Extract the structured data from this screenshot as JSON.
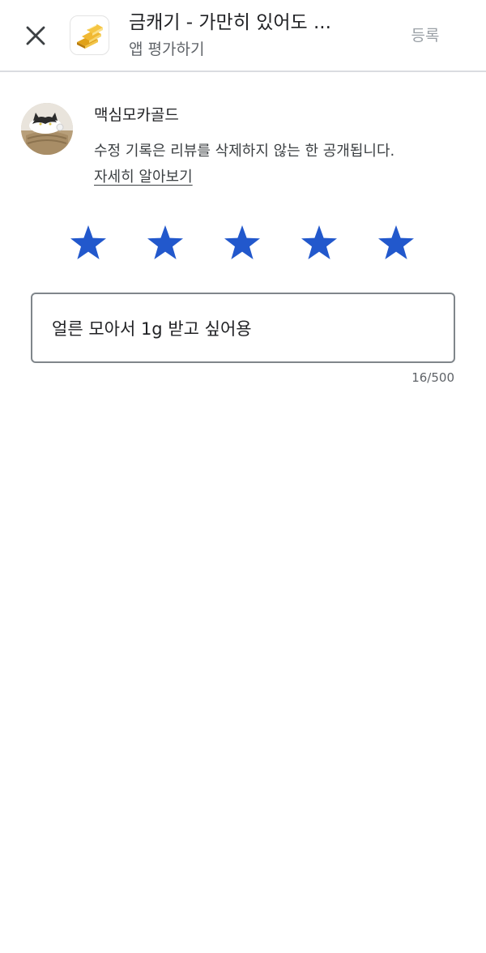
{
  "header": {
    "app_title": "금캐기 - 가만히 있어도 ...",
    "subtitle": "앱 평가하기",
    "submit_label": "등록",
    "close_icon": "close-icon",
    "app_icon": "gold-bars-icon"
  },
  "user": {
    "name": "맥심모카골드",
    "avatar": "cat-avatar"
  },
  "notice": {
    "text": "수정 기록은 리뷰를 삭제하지 않는 한 공개됩니다.",
    "link_label": "자세히 알아보기"
  },
  "rating": {
    "value": 5,
    "max": 5,
    "star_color": "#2258cc"
  },
  "review": {
    "text": "얼른 모아서 1g 받고 싶어용",
    "counter": "16/500"
  }
}
